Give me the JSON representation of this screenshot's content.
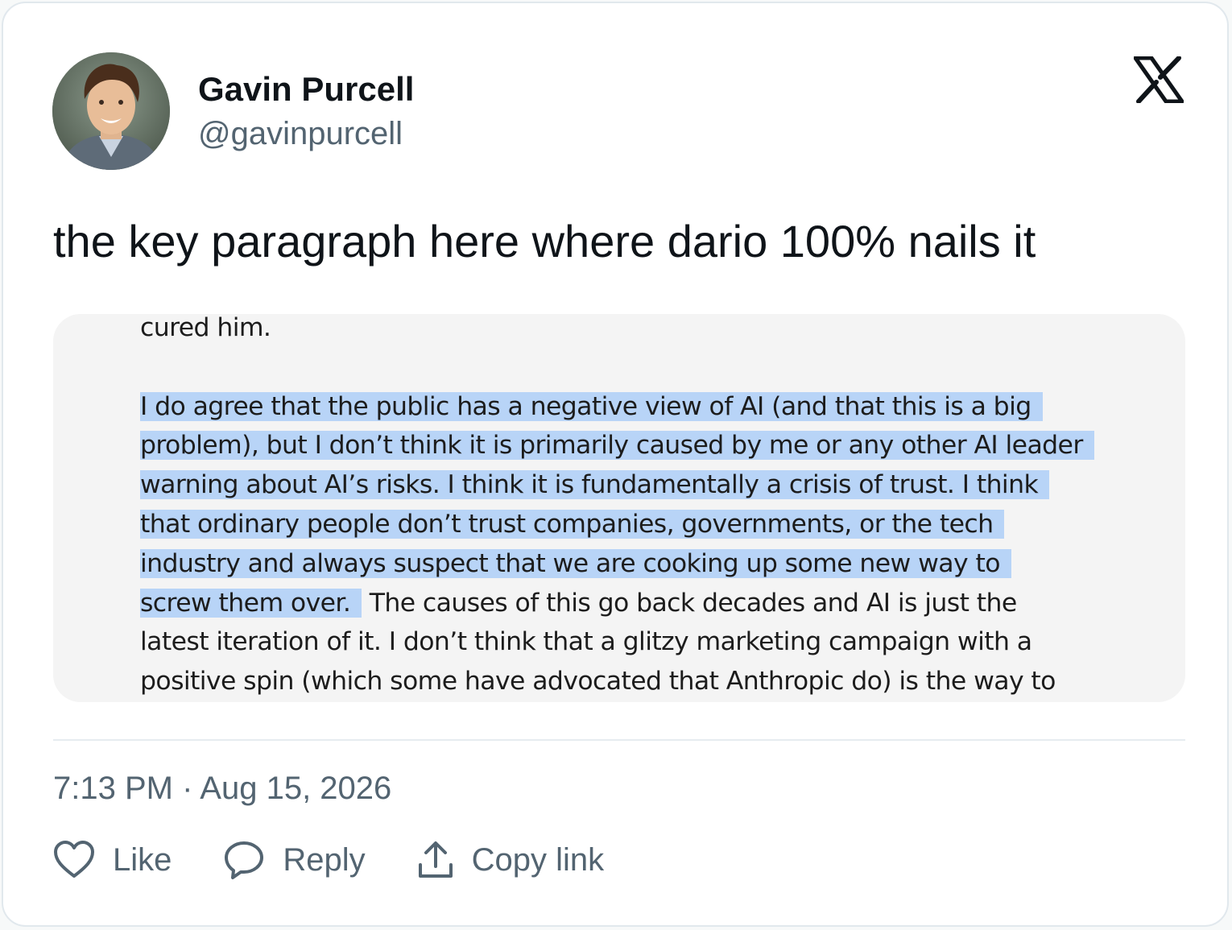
{
  "author": {
    "name": "Gavin Purcell",
    "handle": "@gavinpurcell"
  },
  "tweet": {
    "text": "the key paragraph here where dario 100% nails it"
  },
  "media": {
    "lines": [
      {
        "highlighted": "",
        "plain": "cured him."
      },
      {
        "highlighted": "",
        "plain": ""
      },
      {
        "highlighted": "I do agree that the public has a negative view of AI (and that this is a big",
        "plain": ""
      },
      {
        "highlighted": "problem), but I don’t think it is primarily caused by me or any other AI leader",
        "plain": ""
      },
      {
        "highlighted": "warning about AI’s risks.  I think it is fundamentally a crisis of trust.  I think",
        "plain": ""
      },
      {
        "highlighted": "that ordinary people don’t trust companies, governments, or the tech",
        "plain": ""
      },
      {
        "highlighted": "industry and always suspect that we are cooking up some new way to",
        "plain": ""
      },
      {
        "highlighted": "screw them over.",
        "plain": "The causes of this go back decades and AI is just the"
      },
      {
        "highlighted": "",
        "plain": "latest iteration of it.  I don’t think that a glitzy marketing campaign with a"
      },
      {
        "highlighted": "",
        "plain": "positive spin (which some have advocated that Anthropic do) is the way to"
      }
    ]
  },
  "meta": {
    "timestamp": "7:13 PM · Aug 15, 2026"
  },
  "actions": {
    "like": "Like",
    "reply": "Reply",
    "copy_link": "Copy link"
  },
  "colors": {
    "highlight": "#b8d4f7",
    "text_primary": "#0f1419",
    "text_secondary": "#536471"
  }
}
